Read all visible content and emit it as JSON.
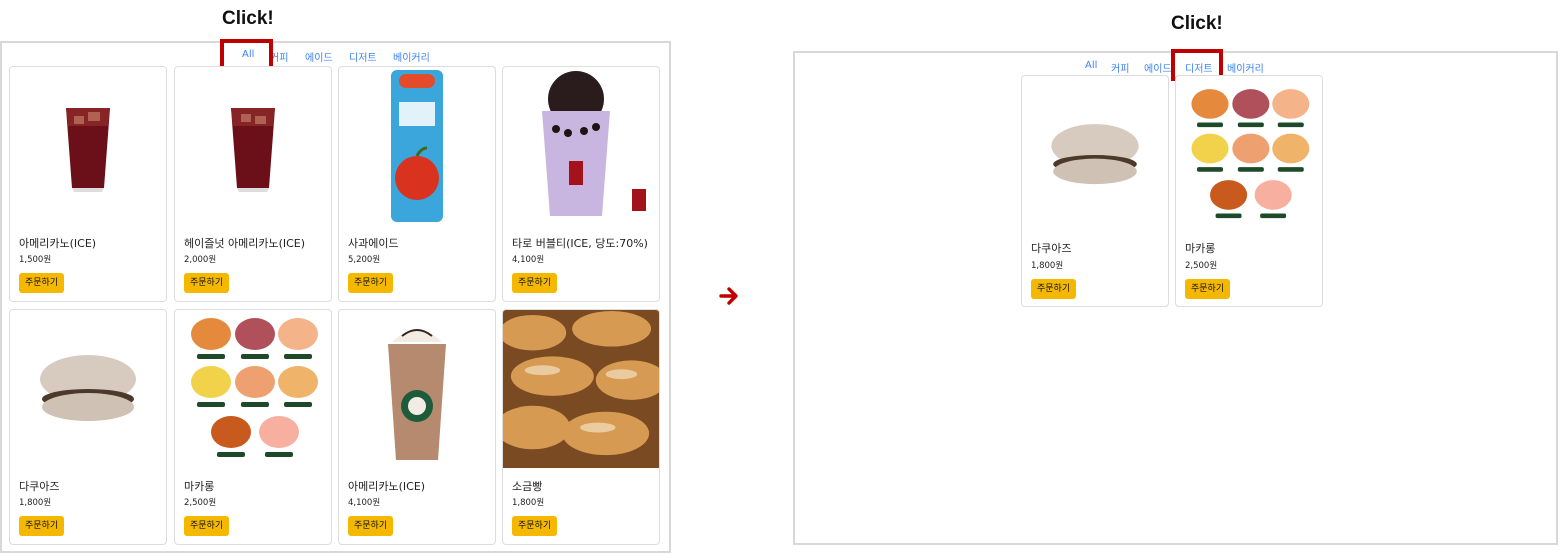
{
  "left": {
    "click_label": "Click!",
    "tabs": [
      "All",
      "커피",
      "에이드",
      "디저트",
      "베이커리"
    ],
    "cards": [
      {
        "title": "아메리카노(ICE)",
        "price": "1,500원",
        "button": "주문하기",
        "icon": "iced-americano-icon"
      },
      {
        "title": "헤이즐넛 아메리카노(ICE)",
        "price": "2,000원",
        "button": "주문하기",
        "icon": "iced-hazelnut-americano-icon"
      },
      {
        "title": "사과에이드",
        "price": "5,200원",
        "button": "주문하기",
        "icon": "apple-ade-can-icon"
      },
      {
        "title": "타로 버블티(ICE, 당도:70%)",
        "price": "4,100원",
        "button": "주문하기",
        "icon": "taro-bubble-tea-icon"
      },
      {
        "title": "다쿠아즈",
        "price": "1,800원",
        "button": "주문하기",
        "icon": "dacquoise-icon"
      },
      {
        "title": "마카롱",
        "price": "2,500원",
        "button": "주문하기",
        "icon": "macaron-assortment-icon"
      },
      {
        "title": "아메리카노(ICE)",
        "price": "4,100원",
        "button": "주문하기",
        "icon": "frappuccino-icon"
      },
      {
        "title": "소금빵",
        "price": "1,800원",
        "button": "주문하기",
        "icon": "salt-bread-icon"
      }
    ]
  },
  "right": {
    "click_label": "Click!",
    "tabs": [
      "All",
      "커피",
      "에이드",
      "디저트",
      "베이커리"
    ],
    "cards": [
      {
        "title": "다쿠아즈",
        "price": "1,800원",
        "button": "주문하기",
        "icon": "dacquoise-icon"
      },
      {
        "title": "마카롱",
        "price": "2,500원",
        "button": "주문하기",
        "icon": "macaron-assortment-icon"
      }
    ]
  },
  "colors": {
    "highlight": "#c00000",
    "tab": "#3b82f6",
    "order_button": "#f5b800",
    "arrow": "#c00000"
  }
}
